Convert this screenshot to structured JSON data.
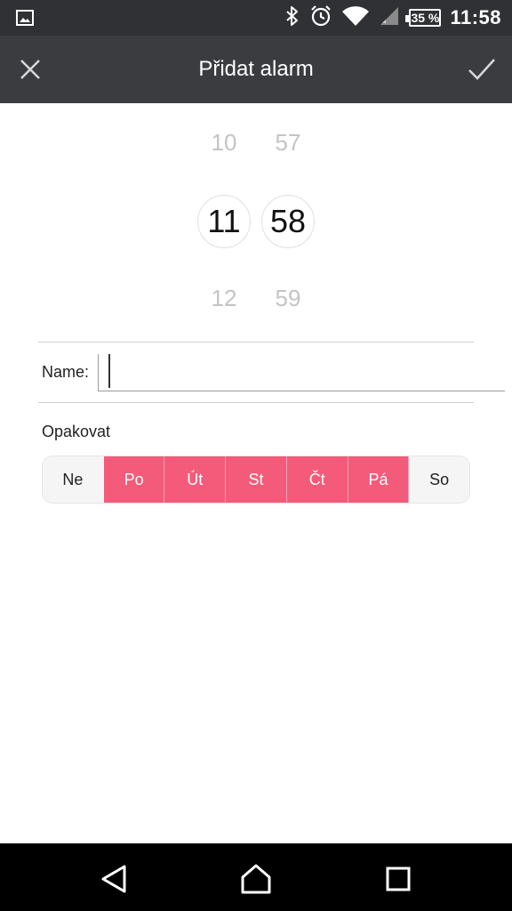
{
  "status_bar": {
    "time": "11:58",
    "battery": "35 %",
    "icons": [
      "image-icon",
      "bluetooth-icon",
      "alarm-clock-icon",
      "wifi-icon",
      "cell-signal-icon",
      "battery-icon"
    ]
  },
  "app_bar": {
    "title": "Přidat alarm",
    "icons": [
      "close-icon",
      "check-icon"
    ]
  },
  "time_picker": {
    "hour_prev": "10",
    "hour_selected": "11",
    "hour_next": "12",
    "minute_prev": "57",
    "minute_selected": "58",
    "minute_next": "59"
  },
  "name_field": {
    "label": "Name:",
    "value": ""
  },
  "repeat": {
    "label": "Opakovat",
    "days": [
      {
        "label": "Ne",
        "selected": false
      },
      {
        "label": "Po",
        "selected": true
      },
      {
        "label": "Út",
        "selected": true
      },
      {
        "label": "St",
        "selected": true
      },
      {
        "label": "Čt",
        "selected": true
      },
      {
        "label": "Pá",
        "selected": true
      },
      {
        "label": "So",
        "selected": false
      }
    ]
  },
  "nav_bar": {
    "icons": [
      "back-icon",
      "home-icon",
      "recents-icon"
    ]
  },
  "colors": {
    "status_bar_bg": "#2f3134",
    "app_bar_bg": "#3a3c40",
    "accent": "#f45b7a",
    "day_off_bg": "#f5f5f5"
  }
}
